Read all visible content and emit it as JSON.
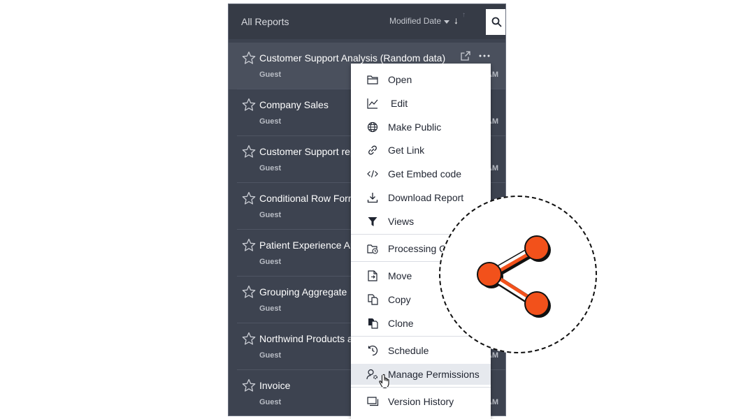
{
  "header": {
    "title": "All Reports",
    "sort_label": "Modified Date",
    "sort_arrow": "↓",
    "sort_arrow_alt": "↑"
  },
  "reports": [
    {
      "name": "Customer Support Analysis (Random data)",
      "owner": "Guest",
      "time": "AM"
    },
    {
      "name": "Company Sales",
      "owner": "Guest",
      "time": "AM"
    },
    {
      "name": "Customer Support rep",
      "owner": "Guest",
      "time": "AM"
    },
    {
      "name": "Conditional Row Form",
      "owner": "Guest",
      "time": ""
    },
    {
      "name": "Patient Experience An",
      "owner": "Guest",
      "time": ""
    },
    {
      "name": "Grouping Aggregate",
      "owner": "Guest",
      "time": ""
    },
    {
      "name": "Northwind Products a",
      "owner": "Guest",
      "time": "AM"
    },
    {
      "name": "Invoice",
      "owner": "Guest",
      "time": "AM"
    }
  ],
  "menu": [
    {
      "label": "Open",
      "icon": "folder-open-icon"
    },
    {
      "label": "Edit",
      "icon": "chart-edit-icon"
    },
    {
      "label": "Make Public",
      "icon": "globe-icon"
    },
    {
      "label": "Get Link",
      "icon": "link-icon"
    },
    {
      "label": "Get Embed code",
      "icon": "code-icon"
    },
    {
      "label": "Download Report",
      "icon": "download-icon"
    },
    {
      "label": "Views",
      "icon": "filter-icon"
    },
    {
      "label": "Processing Q",
      "icon": "folder-clock-icon"
    },
    {
      "label": "Move",
      "icon": "file-move-icon"
    },
    {
      "label": "Copy",
      "icon": "copy-icon"
    },
    {
      "label": "Clone",
      "icon": "clone-icon"
    },
    {
      "label": "Schedule",
      "icon": "history-clock-icon"
    },
    {
      "label": "Manage Permissions",
      "icon": "user-gear-icon"
    },
    {
      "label": "Version History",
      "icon": "versions-icon"
    }
  ],
  "colors": {
    "panel_bg": "#3d4350",
    "share_accent": "#f2511b",
    "menu_hover": "#e6e9ee"
  }
}
